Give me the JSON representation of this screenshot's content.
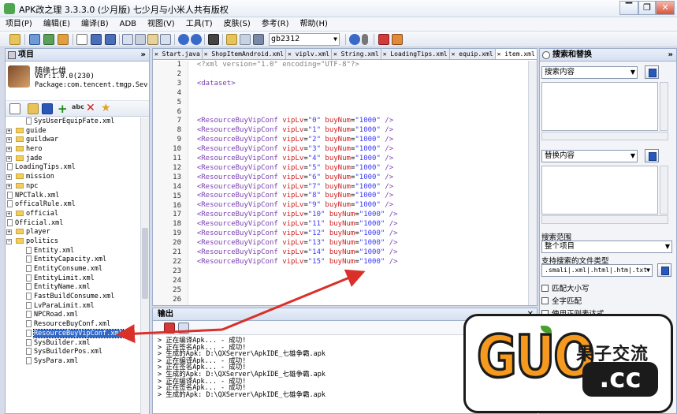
{
  "window": {
    "title": "APK改之理 3.3.3.0 (少月版) 七少月与小米人共有版权",
    "buttons": [
      "▔",
      "❐",
      "✕"
    ]
  },
  "menu": [
    "项目(P)",
    "编辑(E)",
    "编译(B)",
    "ADB",
    "视图(V)",
    "工具(T)",
    "皮肤(S)",
    "参考(R)",
    "帮助(H)"
  ],
  "toolbar": {
    "encoding_value": "gb2312"
  },
  "project_panel": {
    "title": "项目",
    "collapse_icon": "»",
    "project_name": "随缘七雄",
    "version": "Ver:1.0.0(230)",
    "package": "Package:com.tencent.tmgp.SevenHero"
  },
  "tree": [
    {
      "label": "SysUserEquipFate.xml",
      "type": "file",
      "indent": 2
    },
    {
      "label": "guide",
      "type": "folder",
      "indent": 0
    },
    {
      "label": "guildwar",
      "type": "folder",
      "indent": 0
    },
    {
      "label": "hero",
      "type": "folder",
      "indent": 0
    },
    {
      "label": "jade",
      "type": "folder",
      "indent": 0
    },
    {
      "label": "LoadingTips.xml",
      "type": "file",
      "indent": 0
    },
    {
      "label": "mission",
      "type": "folder",
      "indent": 0
    },
    {
      "label": "npc",
      "type": "folder",
      "indent": 0
    },
    {
      "label": "NPCTalk.xml",
      "type": "file",
      "indent": 0
    },
    {
      "label": "officalRule.xml",
      "type": "file",
      "indent": 0
    },
    {
      "label": "official",
      "type": "folder",
      "indent": 0
    },
    {
      "label": "Official.xml",
      "type": "file",
      "indent": 0
    },
    {
      "label": "player",
      "type": "folder",
      "indent": 0
    },
    {
      "label": "politics",
      "type": "folder-open",
      "indent": 0
    },
    {
      "label": "Entity.xml",
      "type": "file",
      "indent": 2
    },
    {
      "label": "EntityCapacity.xml",
      "type": "file",
      "indent": 2
    },
    {
      "label": "EntityConsume.xml",
      "type": "file",
      "indent": 2
    },
    {
      "label": "EntityLimit.xml",
      "type": "file",
      "indent": 2
    },
    {
      "label": "EntityName.xml",
      "type": "file",
      "indent": 2
    },
    {
      "label": "FastBuildConsume.xml",
      "type": "file",
      "indent": 2
    },
    {
      "label": "LvParaLimit.xml",
      "type": "file",
      "indent": 2
    },
    {
      "label": "NPCRoad.xml",
      "type": "file",
      "indent": 2
    },
    {
      "label": "ResourceBuyConf.xml",
      "type": "file",
      "indent": 2
    },
    {
      "label": "ResourceBuyVipConf.xml",
      "type": "file",
      "indent": 2,
      "selected": true
    },
    {
      "label": "SysBuilder.xml",
      "type": "file",
      "indent": 2
    },
    {
      "label": "SysBuilderPos.xml",
      "type": "file",
      "indent": 2
    },
    {
      "label": "SysPara.xml",
      "type": "file",
      "indent": 2
    }
  ],
  "tabs": [
    "Start.java",
    "ShopItemAndroid.xml",
    "viplv.xml",
    "String.xml",
    "LoadingTips.xml",
    "equip.xml",
    "item.xml"
  ],
  "code": [
    {
      "n": "1",
      "decl": "<?xml version=\"1.0\" encoding=\"UTF-8\"?>"
    },
    {
      "n": "2",
      "text": ""
    },
    {
      "n": "3",
      "open": "<dataset>"
    },
    {
      "n": "4",
      "text": ""
    },
    {
      "n": "5",
      "text": ""
    },
    {
      "n": "6",
      "text": ""
    },
    {
      "n": "7",
      "vip": "0",
      "buy": "1000"
    },
    {
      "n": "8",
      "vip": "1",
      "buy": "1000"
    },
    {
      "n": "9",
      "vip": "2",
      "buy": "1000"
    },
    {
      "n": "10",
      "vip": "3",
      "buy": "1000"
    },
    {
      "n": "11",
      "vip": "4",
      "buy": "1000"
    },
    {
      "n": "12",
      "vip": "5",
      "buy": "1000"
    },
    {
      "n": "13",
      "vip": "6",
      "buy": "1000"
    },
    {
      "n": "14",
      "vip": "7",
      "buy": "1000"
    },
    {
      "n": "15",
      "vip": "8",
      "buy": "1000"
    },
    {
      "n": "16",
      "vip": "9",
      "buy": "1000"
    },
    {
      "n": "17",
      "vip": "10",
      "buy": "1000"
    },
    {
      "n": "18",
      "vip": "11",
      "buy": "1000"
    },
    {
      "n": "19",
      "vip": "12",
      "buy": "1000"
    },
    {
      "n": "20",
      "vip": "13",
      "buy": "1000"
    },
    {
      "n": "21",
      "vip": "14",
      "buy": "1000"
    },
    {
      "n": "22",
      "vip": "15",
      "buy": "1000"
    },
    {
      "n": "23",
      "text": ""
    },
    {
      "n": "24",
      "text": ""
    },
    {
      "n": "25",
      "text": ""
    },
    {
      "n": "26",
      "text": ""
    }
  ],
  "output": {
    "title": "输出",
    "close": "✕",
    "lines": [
      "> 正在编译Apk... - 成功!",
      "> 正在签名Apk... - 成功!",
      "> 生成的Apk: D:\\QXServer\\ApkIDE_七雄争霸.apk",
      "> 正在编译Apk... - 成功!",
      "> 正在签名Apk... - 成功!",
      "> 生成的Apk: D:\\QXServer\\ApkIDE_七雄争霸.apk",
      "> 正在编译Apk... - 成功!",
      "> 正在签名Apk... - 成功!",
      "> 生成的Apk: D:\\QXServer\\ApkIDE_七雄争霸.apk"
    ]
  },
  "search_panel": {
    "title": "搜索和替换",
    "collapse_icon": "»",
    "search_label": "搜索内容",
    "replace_label": "替换内容",
    "scope_label": "搜索范围",
    "scope_value": "整个项目",
    "types_label": "支持搜索的文件类型",
    "types_value": ".smali|.xml|.html|.htm|.txt",
    "match_case": "匹配大小写",
    "whole_word": "全字匹配",
    "regex": "使用正则表达式"
  },
  "watermark": {
    "brand": "GUO",
    "name": "果子交流",
    "domain": ".cc"
  }
}
